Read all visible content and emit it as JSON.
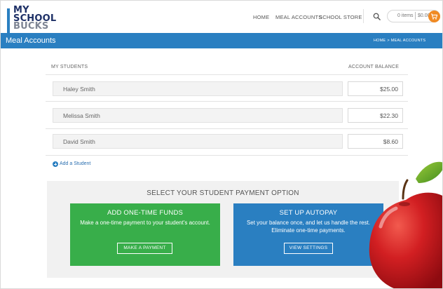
{
  "logo": {
    "line1": "MY",
    "line2": "SCHOOL",
    "line3": "BUCKS"
  },
  "nav": {
    "home": "HOME",
    "meal_accounts": "MEAL ACCOUNTS",
    "school_store": "SCHOOL STORE"
  },
  "cart": {
    "items": "0 items",
    "total": "$0.00"
  },
  "page": {
    "title": "Meal Accounts",
    "breadcrumb": {
      "home": "HOME",
      "separator": ">",
      "current": "MEAL ACCOUNTS"
    }
  },
  "students": {
    "header_students": "MY STUDENTS",
    "header_balance": "ACCOUNT BALANCE",
    "rows": [
      {
        "name": "Haley Smith",
        "balance": "$25.00"
      },
      {
        "name": "Melissa Smith",
        "balance": "$22.30"
      },
      {
        "name": "David Smith",
        "balance": "$8.60"
      }
    ],
    "add_label": "Add a Student"
  },
  "payment": {
    "title": "SELECT YOUR STUDENT PAYMENT OPTION",
    "one_time": {
      "title": "ADD ONE-TIME FUNDS",
      "text": "Make a one-time payment to your student's account.",
      "button": "MAKE A PAYMENT"
    },
    "autopay": {
      "title": "SET UP AUTOPAY",
      "text": "Set your balance once, and let us handle the rest. Eliminate one-time payments.",
      "button": "VIEW SETTINGS"
    }
  },
  "icons": {
    "search": "search-icon",
    "cart": "cart-icon",
    "add": "plus-circle-icon",
    "apple": "apple-image"
  },
  "colors": {
    "brand_blue": "#2a7fc1",
    "navy": "#1d2f66",
    "green": "#38ae4a",
    "orange": "#f08a24",
    "apple_red": "#c8171b"
  }
}
